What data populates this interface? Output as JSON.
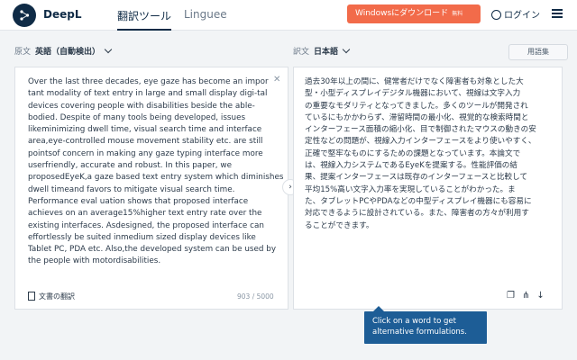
{
  "header": {
    "brand": "DeepL",
    "tabs": [
      {
        "label": "翻訳ツール",
        "active": true
      },
      {
        "label": "Linguee",
        "active": false
      }
    ],
    "download_button": "Windowsにダウンロード",
    "download_badge": "無料",
    "login": "ログイン"
  },
  "source": {
    "label": "原文",
    "language": "英語（自動検出）",
    "lines": [
      "Over the last three decades, eye gaze has become an impor",
      "tant modality of text entry in large and small display digi-tal",
      "devices covering people with disabilities beside the able-",
      "bodied. Despite of many tools being developed, issues",
      "likeminimizing dwell time, visual search time and interface",
      "area,eye-controlled mouse movement stability etc. are still",
      "pointsof concern in making any gaze typing interface more",
      "userfriendly, accurate and robust. In this paper, we",
      "proposedEyeK,a gaze based text entry system which diminishes",
      "dwell timeand favors to mitigate visual search time.",
      "Performance eval uation shows that proposed interface",
      "achieves on an average15%higher text entry rate over the",
      "existing interfaces. Asdesigned, the proposed interface can",
      "effortlessly be suited inmedium sized display devices like",
      "Tablet PC, PDA etc. Also,the developed system can be used by",
      "the people with motordisabilities."
    ],
    "document_button": "文書の翻訳",
    "char_count": "903 / 5000"
  },
  "target": {
    "label": "訳文",
    "language": "日本語",
    "glossary_button": "用語集",
    "lines": [
      "過去30年以上の間に、健常者だけでなく障害者も対象とした大",
      "型・小型ディスプレイデジタル機器において、視線は文字入力",
      "の重要なモダリティとなってきました。多くのツールが開発され",
      "ているにもかかわらず、滞留時間の最小化、視覚的な検索時間と",
      "インターフェース面積の縮小化、目で制御されたマウスの動きの安",
      "定性などの問題が、視線入力インターフェースをより使いやすく、",
      "正確で堅牢なものにするための課題となっています。本論文で",
      "は、視線入力システムであるEyeKを提案する。性能評価の結",
      "果、提案インターフェースは既存のインターフェースと比較して",
      "平均15%高い文字入力率を実現していることがわかった。ま",
      "た、タブレットPCやPDAなどの中型ディスプレイ機器にも容易に",
      "対応できるように設計されている。また、障害者の方々が利用す",
      "ることができます。"
    ]
  },
  "tooltip": "Click on a word to get alternative formulations.",
  "colors": {
    "brand_navy": "#0f2b46",
    "download_orange": "#f26b4a",
    "tooltip_blue": "#1d5d96"
  }
}
